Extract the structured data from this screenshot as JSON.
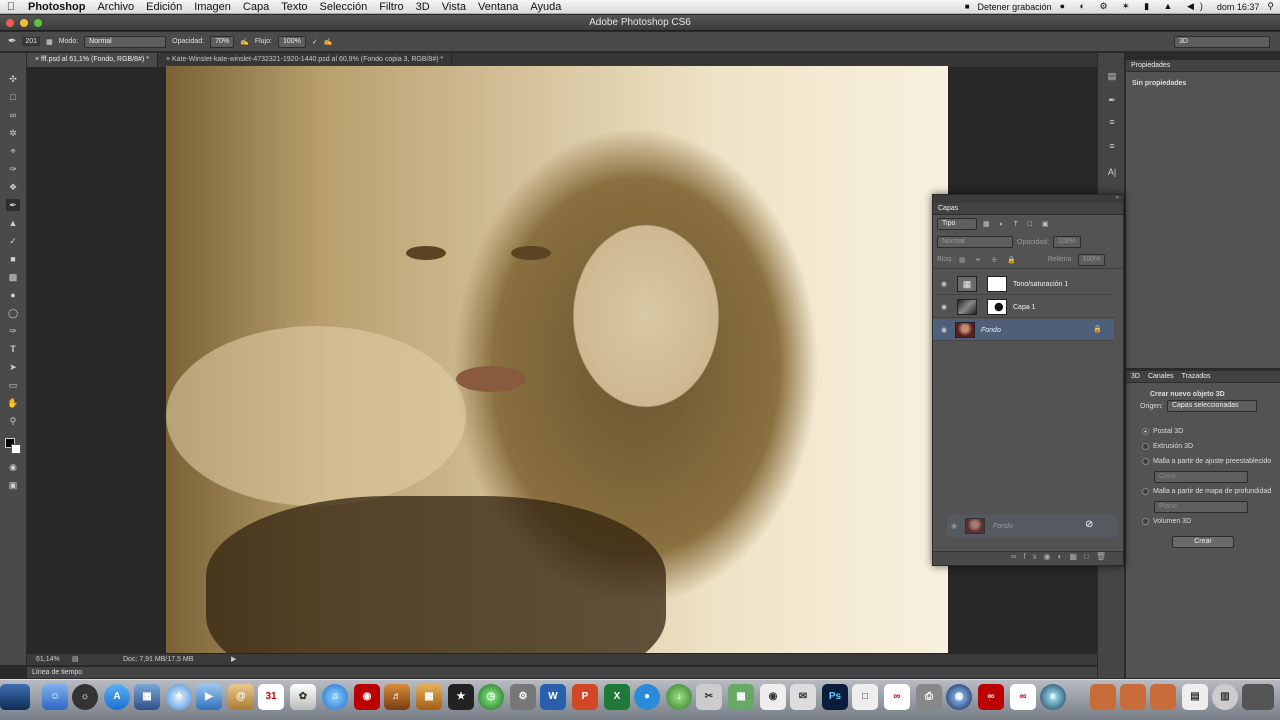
{
  "menubar": {
    "app": "Photoshop",
    "items": [
      "Archivo",
      "Edición",
      "Imagen",
      "Capa",
      "Texto",
      "Selección",
      "Filtro",
      "3D",
      "Vista",
      "Ventana",
      "Ayuda"
    ],
    "record": "Detener grabación",
    "clock": "dom 16:37"
  },
  "window": {
    "title": "Adobe Photoshop CS6"
  },
  "options": {
    "brush_size": "201",
    "mode_label": "Modo:",
    "mode_value": "Normal",
    "opacity_label": "Opacidad:",
    "opacity_value": "70%",
    "flow_label": "Flujo:",
    "flow_value": "100%",
    "workspace": "3D"
  },
  "tabs": [
    "fff.psd al 61,1% (Fondo, RGB/8#) *",
    "Kate-Winslet-kate-winslet-4732321-1920-1440.psd al 60,9% (Fondo copia 3, RGB/8#) *"
  ],
  "status": {
    "zoom": "61,14%",
    "doc": "Doc: 7,91 MB/17,5 MB"
  },
  "timeline": {
    "label": "Línea de tiempo"
  },
  "properties": {
    "title": "Propiedades",
    "empty": "Sin propiedades"
  },
  "layers": {
    "title": "Capas",
    "filter": "Tipo",
    "blend": "Normal",
    "opacity_label": "Opacidad:",
    "opacity": "100%",
    "lock_label": "Bloq.:",
    "fill_label": "Relleno:",
    "fill": "100%",
    "items": [
      {
        "name": "Tono/saturación 1"
      },
      {
        "name": "Capa 1"
      },
      {
        "name": "Fondo"
      }
    ],
    "drag_item": "Fondo"
  },
  "panel3d": {
    "tabs": [
      "3D",
      "Canales",
      "Trazados"
    ],
    "heading": "Crear nuevo objeto 3D",
    "origin_label": "Origen:",
    "origin_value": "Capas seleccionadas",
    "options": [
      "Postal 3D",
      "Extrusión 3D",
      "Malla a partir de ajuste preestablecido",
      "Malla a partir de mapa de profundidad",
      "Volumen 3D"
    ],
    "preset_value": "Cono",
    "depth_value": "Plano",
    "create": "Crear"
  },
  "dock": {
    "calendar_day": "31",
    "ps": "Ps",
    "word": "W",
    "excel": "X"
  }
}
